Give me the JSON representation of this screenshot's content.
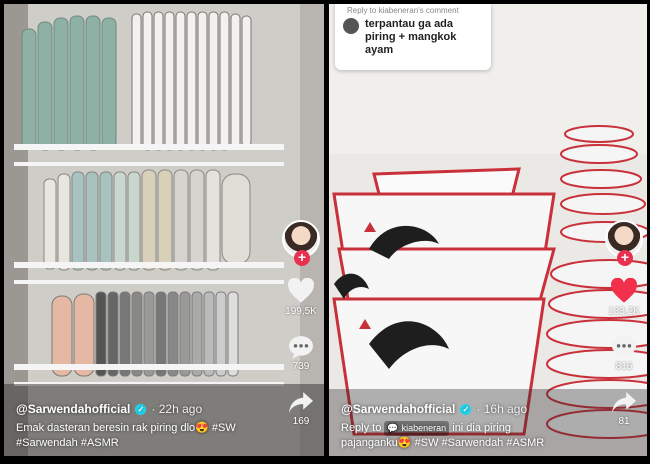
{
  "left": {
    "likes": "199,5K",
    "comments": "739",
    "shares": "169",
    "username": "@Sarwendahofficial",
    "time": "22h ago",
    "caption_line1": "Emak dasteran beresin rak piring dlo😍 #SW",
    "caption_line2": "#Sarwendah #ASMR"
  },
  "right": {
    "comment_reply_to": "Reply to kiabeneran's comment",
    "comment_text": "terpantau ga ada piring + mangkok ayam",
    "likes": "133,2K",
    "comments": "816",
    "shares": "81",
    "username": "@Sarwendahofficial",
    "time": "16h ago",
    "reply_prefix": "Reply to",
    "reply_mention": "kiabeneran",
    "caption_tail": "ini dia piring",
    "caption_line2": "pajanganku😍 #SW #Sarwendah #ASMR"
  },
  "colors": {
    "like_red": "#f2304c",
    "verified": "#20d5ec",
    "rooster_rim": "#c9313a"
  }
}
